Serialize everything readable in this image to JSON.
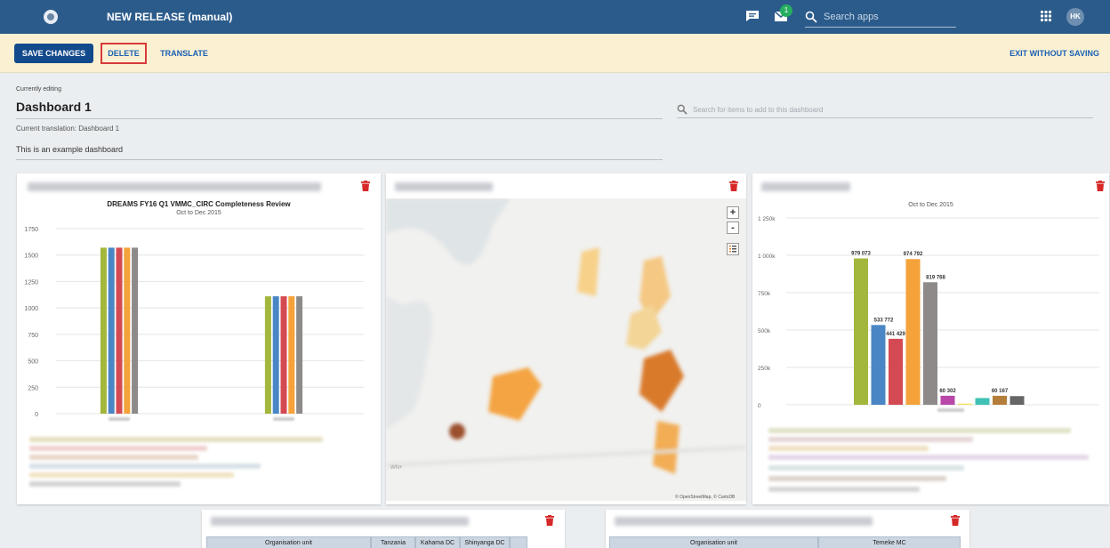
{
  "header": {
    "title": "NEW RELEASE (manual)",
    "notification_count": "1",
    "search_placeholder": "Search apps",
    "user_initials": "HK"
  },
  "editbar": {
    "save_label": "SAVE CHANGES",
    "delete_label": "DELETE",
    "translate_label": "TRANSLATE",
    "exit_label": "EXIT WITHOUT SAVING",
    "highlight_color": "#d93a3a"
  },
  "editor": {
    "currently_editing": "Currently editing",
    "dashboard_name": "Dashboard 1",
    "current_translation": "Current translation: Dashboard 1",
    "description": "This is an example dashboard",
    "item_search_placeholder": "Search for items to add to this dashboard"
  },
  "cards": {
    "chart1": {
      "title": "DREAMS FY16 Q1 VMMC_CIRC Completeness Review",
      "subtitle": "Oct to Dec 2015"
    },
    "map": {
      "zoom_in": "+",
      "zoom_out": "-",
      "attribution": "© OpenStreetMap, © CartoDB",
      "corner_label": "WN+"
    },
    "chart2": {
      "subtitle": "Oct to Dec 2015"
    },
    "table1": {
      "headers": [
        "Organisation unit",
        "Tanzania",
        "Kahama DC",
        "Shinyanga DC"
      ]
    },
    "table2": {
      "headers": [
        "Organisation unit",
        "Temeke MC"
      ]
    }
  },
  "chart_data": [
    {
      "type": "bar",
      "title": "DREAMS FY16 Q1 VMMC_CIRC Completeness Review",
      "subtitle": "Oct to Dec 2015",
      "ylim": [
        0,
        1750
      ],
      "yticks": [
        0,
        250,
        500,
        750,
        1000,
        1250,
        1500,
        1750
      ],
      "groups": [
        {
          "values": [
            1570,
            1570,
            1570,
            1570,
            1570
          ]
        },
        {
          "values": [
            1110,
            1110,
            1110,
            1110,
            1110
          ]
        }
      ],
      "colors": [
        "#a2b73c",
        "#4a86c5",
        "#d44a53",
        "#f5a23a",
        "#8e8a8a"
      ]
    },
    {
      "type": "bar",
      "subtitle": "Oct to Dec 2015",
      "ylim": [
        0,
        1250000
      ],
      "yticks": [
        0,
        250000,
        500000,
        750000,
        1000000,
        1250000
      ],
      "ytick_labels": [
        "0",
        "250k",
        "500k",
        "750k",
        "1 000k",
        "1 250k"
      ],
      "bars": [
        {
          "value": 979073,
          "label": "979 073",
          "color": "#a2b73c"
        },
        {
          "value": 533772,
          "label": "533 772",
          "color": "#4a86c5"
        },
        {
          "value": 441429,
          "label": "441 429",
          "color": "#d44a53"
        },
        {
          "value": 974792,
          "label": "974 792",
          "color": "#f5a23a"
        },
        {
          "value": 819768,
          "label": "819 768",
          "color": "#8e8a8a"
        },
        {
          "value": 60302,
          "label": "60 302",
          "color": "#b847a8"
        },
        {
          "value": 8000,
          "label": "",
          "color": "#f2e26a"
        },
        {
          "value": 45000,
          "label": "",
          "color": "#3fc1b5"
        },
        {
          "value": 60167,
          "label": "60 167",
          "color": "#b57d3a"
        },
        {
          "value": 58000,
          "label": "",
          "color": "#666666"
        }
      ]
    }
  ]
}
